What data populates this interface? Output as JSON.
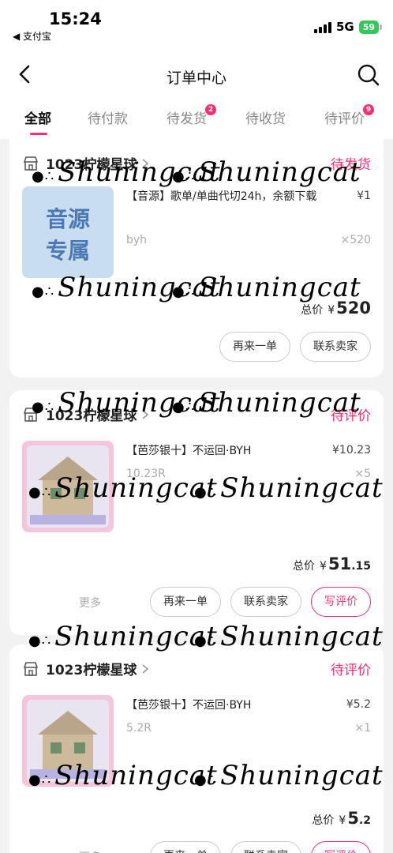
{
  "status_bar": {
    "time": "15:24",
    "back_app": "◀ 支付宝",
    "network": "5G",
    "battery": "59"
  },
  "nav": {
    "title": "订单中心"
  },
  "tabs": [
    {
      "label": "全部",
      "badge": ""
    },
    {
      "label": "待付款",
      "badge": ""
    },
    {
      "label": "待发货",
      "badge": "2"
    },
    {
      "label": "待收货",
      "badge": ""
    },
    {
      "label": "待评价",
      "badge": "9"
    }
  ],
  "orders": [
    {
      "shop": "1023柠檬星球",
      "status": "待发货",
      "thumb_text_1": "音源",
      "thumb_text_2": "专属",
      "item_title": "【音源】歌单/单曲代切24h，余额下载",
      "price": "¥1",
      "spec": "byh",
      "qty": "×520",
      "total_label": "总价",
      "total_currency": "¥",
      "total_int": "520",
      "total_dec": "",
      "buttons": [
        "再来一单",
        "联系卖家"
      ]
    },
    {
      "shop": "1023柠檬星球",
      "status": "待评价",
      "item_title": "【芭莎银十】不运回·BYH",
      "price": "¥10.23",
      "spec": "10.23R",
      "qty": "×5",
      "total_label": "总价",
      "total_currency": "¥",
      "total_int": "51",
      "total_dec": ".15",
      "more": "更多",
      "buttons": [
        "再来一单",
        "联系卖家",
        "写评价"
      ]
    },
    {
      "shop": "1023柠檬星球",
      "status": "待评价",
      "item_title": "【芭莎银十】不运回·BYH",
      "price": "¥5.2",
      "spec": "5.2R",
      "qty": "×1",
      "total_label": "总价",
      "total_currency": "¥",
      "total_int": "5",
      "total_dec": ".2",
      "more": "更多",
      "buttons": [
        "再来一单",
        "联系卖家",
        "写评价"
      ]
    }
  ],
  "watermark": "Shuningcat",
  "colors": {
    "accent": "#ff2d6f",
    "battery": "#34c759",
    "thumb_blue": "#c8ddf0",
    "thumb_pink": "#f3c6dc"
  },
  "icons": [
    "back-icon",
    "search-icon",
    "shop-icon",
    "chevron-right-icon",
    "signal-icon",
    "battery-icon"
  ]
}
